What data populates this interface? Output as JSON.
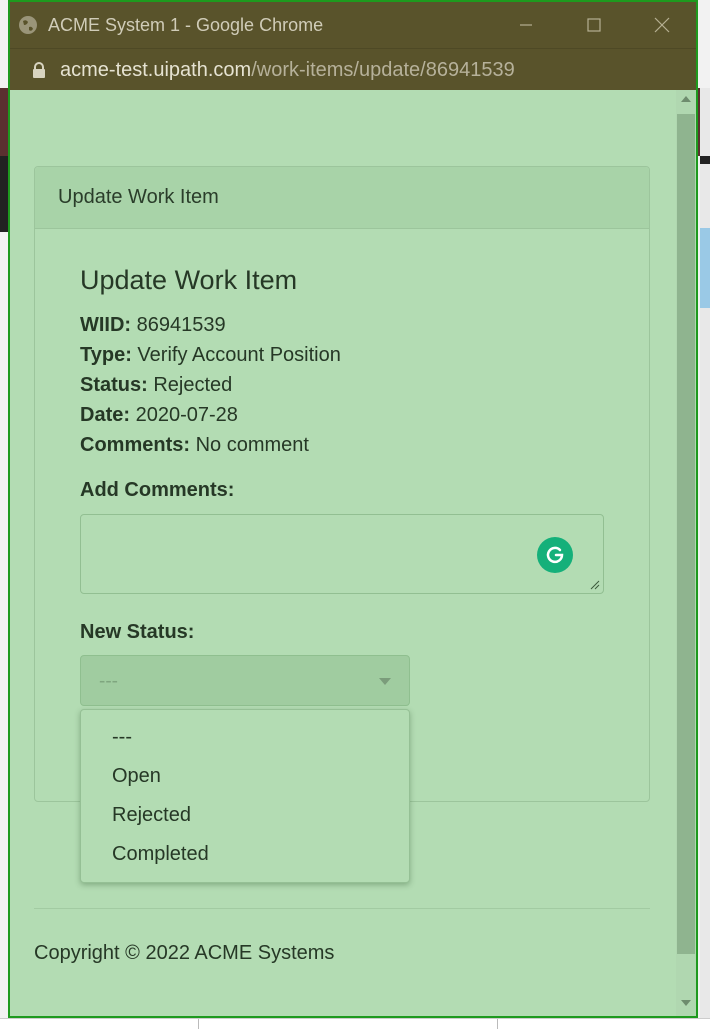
{
  "browser": {
    "window_title": "ACME System 1 - Google Chrome",
    "url_host": "acme-test.uipath.com",
    "url_path": "/work-items/update/86941539"
  },
  "card": {
    "header": "Update Work Item"
  },
  "work_item": {
    "title": "Update Work Item",
    "fields": [
      {
        "label": "WIID:",
        "value": "86941539"
      },
      {
        "label": "Type:",
        "value": "Verify Account Position"
      },
      {
        "label": "Status:",
        "value": "Rejected"
      },
      {
        "label": "Date:",
        "value": "2020-07-28"
      },
      {
        "label": "Comments:",
        "value": "No comment"
      }
    ],
    "add_comments_label": "Add Comments:",
    "new_status_label": "New Status:",
    "status_select_value": "---",
    "status_options": [
      "---",
      "Open",
      "Rejected",
      "Completed"
    ]
  },
  "footer": {
    "copyright": "Copyright © 2022 ACME Systems"
  },
  "colors": {
    "titlebar": "#59532b",
    "page_bg": "#b3dcb3",
    "window_border": "#1e9a1e",
    "grammarly": "#15b07a"
  }
}
